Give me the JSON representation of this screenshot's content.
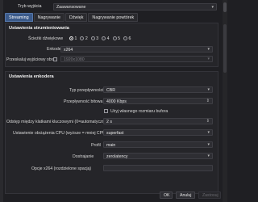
{
  "mode": {
    "label": "Tryb wyjścia",
    "value": "Zaawansowane"
  },
  "tabs": [
    {
      "label": "Streaming",
      "active": true
    },
    {
      "label": "Nagrywanie",
      "active": false
    },
    {
      "label": "Dźwięk",
      "active": false
    },
    {
      "label": "Nagrywanie powtórek",
      "active": false
    }
  ],
  "streaming": {
    "title": "Ustawienia strumieniowania",
    "track_label": "Ścieżki dźwiękowe",
    "tracks": [
      "1",
      "2",
      "3",
      "4",
      "5",
      "6"
    ],
    "selected_track": "1",
    "encoder_label": "Enkoder",
    "encoder_value": "x264",
    "rescale_label": "Przeskaluj wyjściowy obraz",
    "rescale_value": "1920x1080"
  },
  "encoder": {
    "title": "Ustawienia enkodera",
    "rate_control_label": "Typ przepływności",
    "rate_control_value": "CBR",
    "bitrate_label": "Przepływność bitowa",
    "bitrate_value": "4000 Kbps",
    "custom_buffer_label": "Użyj własnego rozmiaru bufora",
    "keyframe_label": "Odstęp między klatkami kluczowymi (0=automatyczny)",
    "keyframe_value": "2 s",
    "preset_label": "Ustawienie obciążenia CPU (wyższe = mniej CPU)",
    "preset_value": "superfast",
    "profile_label": "Profil",
    "profile_value": "main",
    "tune_label": "Dostrajanie",
    "tune_value": "zerolatency",
    "x264opts_label": "Opcje x264 (rozdzielone spacją)",
    "x264opts_value": ""
  },
  "buttons": {
    "ok": "OK",
    "cancel": "Anuluj",
    "apply": "Zastosuj"
  },
  "icons": {
    "dropdown": "chevron-down-icon",
    "spin": "spin-arrows-icon"
  },
  "colors": {
    "accent": "#3b5a8a",
    "background": "#1f1f23"
  }
}
